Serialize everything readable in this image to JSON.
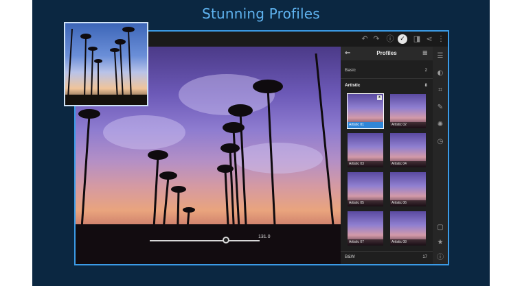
{
  "headline": "Stunning Profiles",
  "panel": {
    "title": "Profiles",
    "groups": [
      {
        "label": "Basic",
        "count": "2"
      },
      {
        "label": "Artistic",
        "count": "8"
      },
      {
        "label": "B&W",
        "count": "17"
      }
    ],
    "thumbnails": [
      {
        "label": "Artistic 01"
      },
      {
        "label": "Artistic 02"
      },
      {
        "label": "Artistic 03"
      },
      {
        "label": "Artistic 04"
      },
      {
        "label": "Artistic 05"
      },
      {
        "label": "Artistic 06"
      },
      {
        "label": "Artistic 07"
      },
      {
        "label": "Artistic 08"
      }
    ],
    "selected": "Artistic 01"
  },
  "slider": {
    "value": "131.0"
  },
  "icons": {
    "undo": "undo-icon",
    "redo": "redo-icon",
    "help": "help-icon",
    "done": "check-icon",
    "compare": "compare-icon",
    "share": "share-icon",
    "more": "more-icon",
    "back": "back-arrow-icon",
    "menu": "menu-icon"
  },
  "colors": {
    "accent": "#3b9be6",
    "background": "#0b2741",
    "selected_label": "#2f86d8"
  }
}
